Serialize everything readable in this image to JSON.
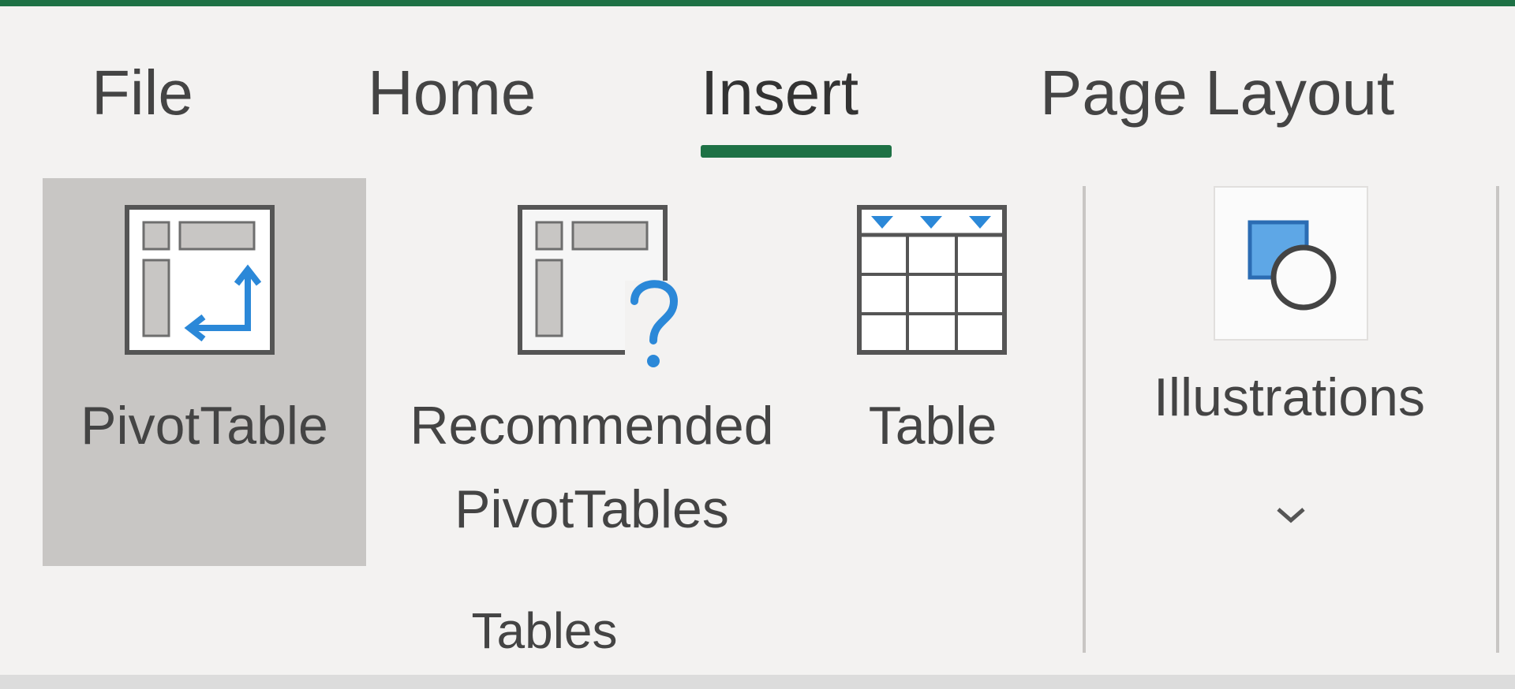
{
  "tabs": {
    "file": "File",
    "home": "Home",
    "insert": "Insert",
    "page_layout": "Page Layout",
    "active": "Insert"
  },
  "ribbon": {
    "tables_group": {
      "label": "Tables",
      "pivot_table": {
        "label": "PivotTable",
        "icon": "pivot-table-icon",
        "state": "hovered"
      },
      "recommended": {
        "label_line1": "Recommended",
        "label_line2": "PivotTables",
        "icon": "recommended-pivottables-icon"
      },
      "table": {
        "label": "Table",
        "icon": "table-icon"
      }
    },
    "illustrations": {
      "label": "Illustrations",
      "icon": "shapes-icon",
      "dropdown": "chevron-down-icon"
    }
  },
  "colors": {
    "accent": "#1e7145",
    "background": "#f3f2f1",
    "hover": "#c8c6c4",
    "icon_blue": "#2b88d8",
    "text": "#444444"
  }
}
